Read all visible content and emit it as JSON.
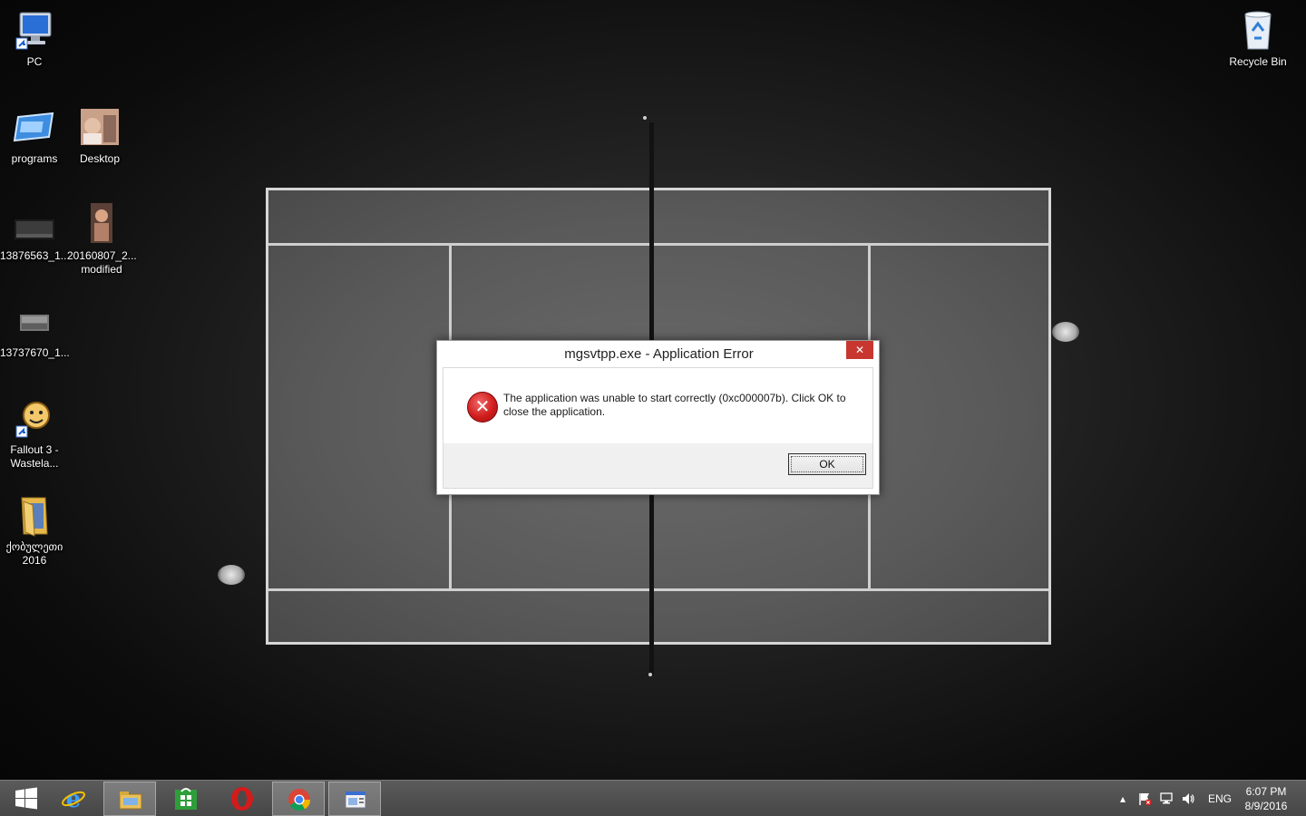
{
  "desktop": {
    "icons": [
      {
        "label": "PC",
        "icon": "computer-icon",
        "shortcut": true
      },
      {
        "label": "programs",
        "icon": "programs-icon"
      },
      {
        "label": "Desktop",
        "icon": "photo-thumbnail-icon"
      },
      {
        "label": "13876563_1...",
        "icon": "image-thumbnail-icon"
      },
      {
        "label": "20160807_2... modified",
        "icon": "photo-thumbnail-icon"
      },
      {
        "label": "13737670_1...",
        "icon": "image-thumbnail-icon"
      },
      {
        "label": "Fallout 3 - Wastela...",
        "icon": "fallout-icon",
        "shortcut": true
      },
      {
        "label": "ქობულეთი 2016",
        "icon": "folder-icon"
      },
      {
        "label": "Recycle Bin",
        "icon": "recycle-bin-icon"
      }
    ]
  },
  "dialog": {
    "title": "mgsvtpp.exe - Application Error",
    "close_glyph": "✕",
    "icon": "error-icon",
    "message": "The application was unable to start correctly (0xc000007b). Click OK to close the application.",
    "ok_label": "OK"
  },
  "taskbar": {
    "items": [
      {
        "name": "start-button",
        "icon": "windows-logo-icon"
      },
      {
        "name": "internet-explorer",
        "icon": "internet-explorer-icon"
      },
      {
        "name": "file-explorer",
        "icon": "file-explorer-icon",
        "active": true
      },
      {
        "name": "store",
        "icon": "store-icon"
      },
      {
        "name": "opera",
        "icon": "opera-icon"
      },
      {
        "name": "chrome",
        "icon": "chrome-icon",
        "active": true
      },
      {
        "name": "application-window",
        "icon": "app-window-icon",
        "active": true
      }
    ],
    "tray": {
      "language": "ENG",
      "time": "6:07 PM",
      "date": "8/9/2016",
      "icons": [
        "show-hidden-icons-icon",
        "action-center-flag-icon",
        "network-icon",
        "volume-icon"
      ]
    }
  }
}
